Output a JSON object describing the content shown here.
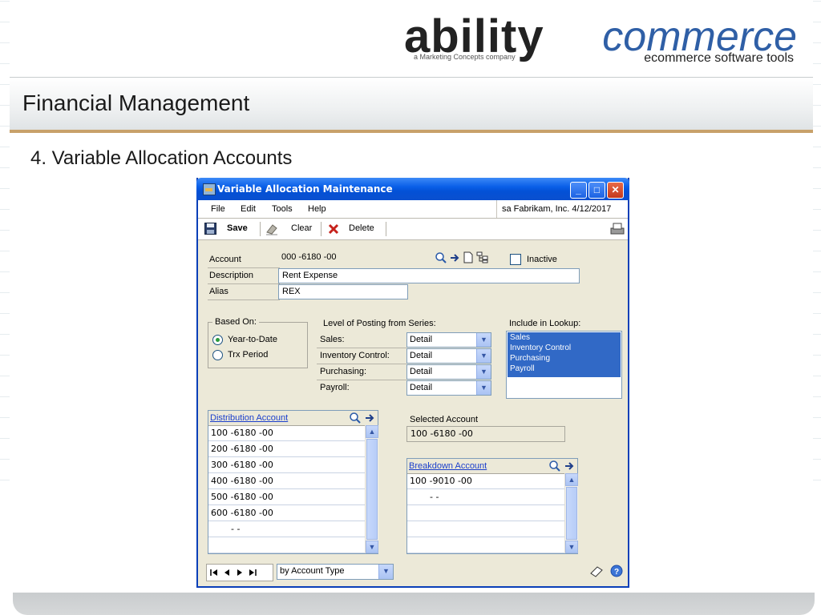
{
  "slide": {
    "logo_word1": "ability",
    "logo_word2": "commerce",
    "logo_sub": "a Marketing Concepts company",
    "logo_tagline": "ecommerce software tools",
    "title": "Financial Management",
    "subtitle": "4.  Variable Allocation Accounts"
  },
  "window": {
    "title": "Variable Allocation Maintenance",
    "menu": [
      "File",
      "Edit",
      "Tools",
      "Help"
    ],
    "context": "sa  Fabrikam, Inc.  4/12/2017",
    "toolbar": {
      "save": "Save",
      "clear": "Clear",
      "delete": "Delete"
    },
    "fields": {
      "account_label": "Account",
      "account_value": "000 -6180 -00",
      "inactive_label": "Inactive",
      "description_label": "Description",
      "description_value": "Rent Expense",
      "alias_label": "Alias",
      "alias_value": "REX"
    },
    "based_on": {
      "label": "Based On:",
      "options": [
        "Year-to-Date",
        "Trx Period"
      ],
      "selected": "Year-to-Date"
    },
    "posting": {
      "label": "Level of Posting from Series:",
      "rows": [
        {
          "label": "Sales:",
          "value": "Detail"
        },
        {
          "label": "Inventory Control:",
          "value": "Detail"
        },
        {
          "label": "Purchasing:",
          "value": "Detail"
        },
        {
          "label": "Payroll:",
          "value": "Detail"
        }
      ]
    },
    "lookup": {
      "label": "Include in Lookup:",
      "items": [
        "Sales",
        "Inventory Control",
        "Purchasing",
        "Payroll"
      ]
    },
    "distribution": {
      "header": "Distribution Account",
      "rows": [
        "100 -6180 -00",
        "200 -6180 -00",
        "300 -6180 -00",
        "400 -6180 -00",
        "500 -6180 -00",
        "600 -6180 -00",
        "-        -",
        ""
      ]
    },
    "selected": {
      "label": "Selected Account",
      "value": "100 -6180 -00"
    },
    "breakdown": {
      "header": "Breakdown Account",
      "rows": [
        "100 -9010 -00",
        "-        -",
        "",
        "",
        ""
      ]
    },
    "statusbar": {
      "sort_value": "by Account Type"
    }
  }
}
